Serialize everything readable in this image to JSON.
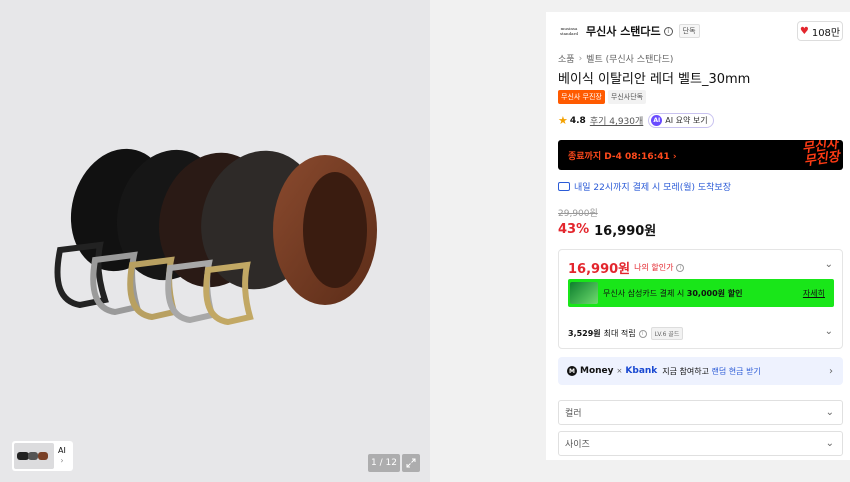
{
  "gallery": {
    "ai_label": "AI",
    "pager": "1 / 12"
  },
  "brand": {
    "logo_line1": "musinsa",
    "logo_line2": "standard",
    "name": "무신사 스탠다드",
    "exclusive_badge": "단독"
  },
  "like": {
    "count": "108만"
  },
  "breadcrumb": [
    "소품",
    "벨트 (무신사 스탠다드)"
  ],
  "product": {
    "title": "베이식 이탈리안 레더 벨트_30mm",
    "tags": [
      "무신사 무진장",
      "무신사단독"
    ]
  },
  "rating": {
    "score": "4.8",
    "reviews": "후기 4,930개",
    "ai_summary": "AI 요약 보기"
  },
  "promo": {
    "countdown": "종료까지 D-4 08:16:41 ›",
    "brand_line1": "무신사",
    "brand_line2": "무진장"
  },
  "delivery": {
    "text": "내일 22시까지 결제 시 모레(월) 도착보장"
  },
  "pricing": {
    "original": "29,900원",
    "discount": "43%",
    "sale": "16,990원"
  },
  "benefit": {
    "my_price": "16,990원",
    "my_price_label": "나의 할인가",
    "card_text": "무신사 삼성카드 결제 시",
    "card_amount": "30,000원 할인",
    "card_more": "자세히",
    "points_amount": "3,529원",
    "points_label": "최대 적립",
    "level": "LV.6 골드"
  },
  "money": {
    "brand": "Money",
    "x": "×",
    "partner": "Kbank",
    "text": "지금 참여하고",
    "highlight": "랜덤 현금 받기"
  },
  "options": {
    "color": "컬러",
    "size": "사이즈"
  },
  "colors": {
    "accent_red": "#e3262d",
    "promo_orange": "#ff5a00",
    "card_green": "#19e619",
    "link_blue": "#2b5bd7"
  }
}
